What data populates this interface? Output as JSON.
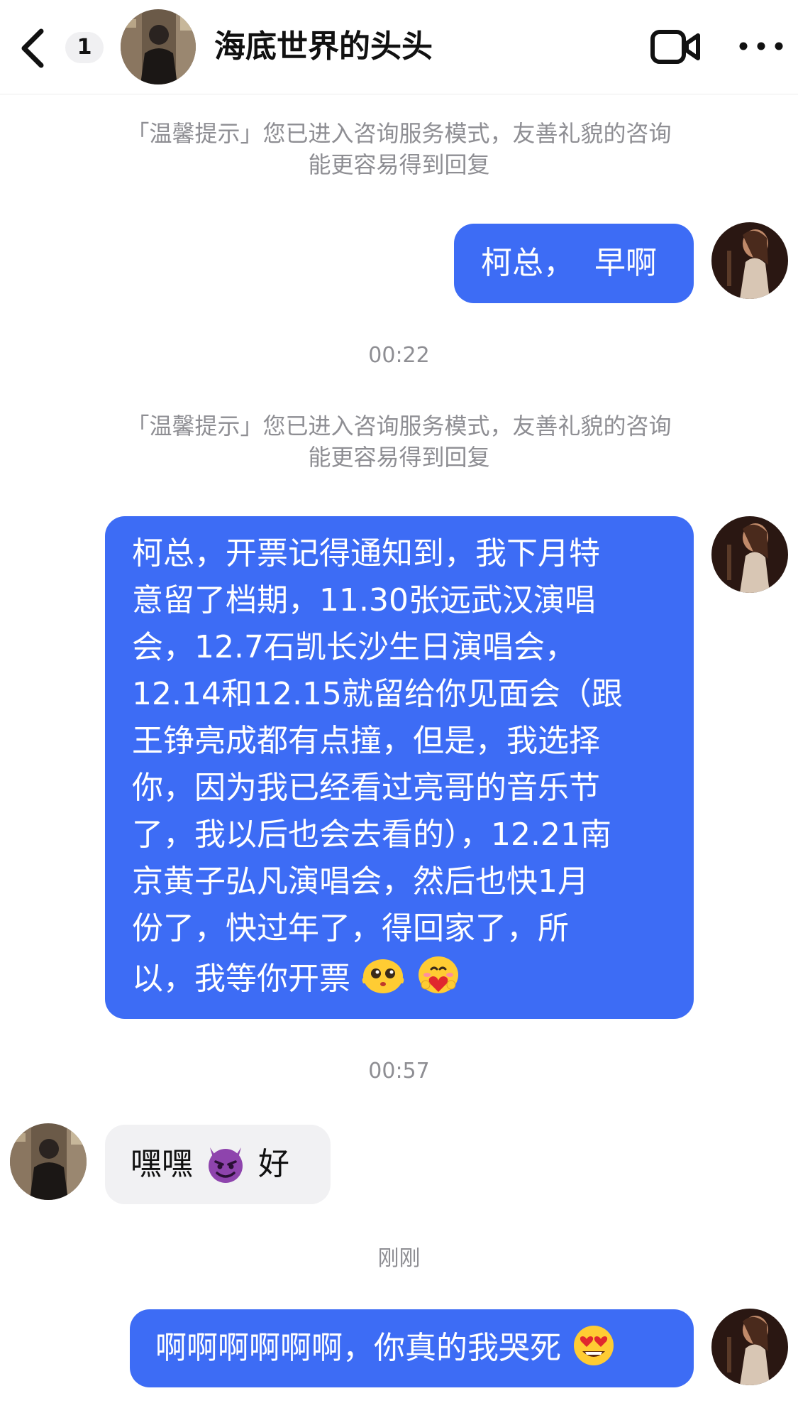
{
  "header": {
    "back_icon": "chevron-left-icon",
    "unread_count": "1",
    "contact_name": "海底世界的头头",
    "video_icon": "video-camera-icon",
    "more_icon": "ellipsis-icon"
  },
  "chat": {
    "tip_line1": "「温馨提示」您已进入咨询服务模式，友善礼貌的咨询",
    "tip_line2": "能更容易得到回复",
    "messages": [
      {
        "sender": "me",
        "text": "柯总，  早啊"
      },
      {
        "time": "00:22"
      },
      {
        "sender": "me",
        "text": "柯总，开票记得通知到，我下月特意留了档期，11.30张远武汉演唱会，12.7石凯长沙生日演唱会，12.14和12.15就留给你见面会（跟王铮亮成都有点撞，但是，我选择你，因为我已经看过亮哥的音乐节了，我以后也会去看的），12.21南京黄子弘凡演唱会，然后也快1月份了，快过年了，得回家了，所以，我等你开票",
        "lines": [
          "柯总，开票记得通知到，我下月特",
          "意留了档期，11.30张远武汉演唱",
          "会，12.7石凯长沙生日演唱会，",
          "12.14和12.15就留给你见面会（跟",
          "王铮亮成都有点撞，但是，我选择",
          "你，因为我已经看过亮哥的音乐节",
          "了，我以后也会去看的），12.21南",
          "京黄子弘凡演唱会，然后也快1月",
          "份了，快过年了，得回家了，所",
          "以，我等你开票"
        ],
        "emojis": [
          "pleading-face-icon",
          "heart-hug-icon"
        ]
      },
      {
        "time": "00:57"
      },
      {
        "sender": "contact",
        "text_before": "嘿嘿",
        "emoji": "smiling-devil-icon",
        "text_after": "好"
      },
      {
        "time": "刚刚"
      },
      {
        "sender": "me",
        "text": "啊啊啊啊啊啊，你真的我哭死",
        "emoji": "heart-eyes-icon"
      }
    ]
  },
  "colors": {
    "outgoing_bubble": "#3d6cf5",
    "incoming_bubble": "#f1f1f3",
    "system_text": "#8e8e93"
  }
}
